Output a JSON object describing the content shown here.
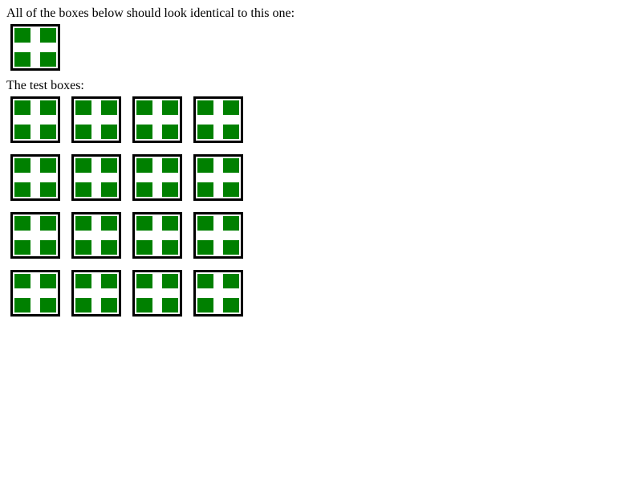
{
  "intro": {
    "text": "All of the boxes below should look identical to this one:"
  },
  "test": {
    "label": "The test boxes:",
    "rows": 4,
    "cols": 4
  },
  "colors": {
    "quadrant": "#008000",
    "border": "#000000",
    "background": "#ffffff"
  },
  "icons": {
    "box": "green-cross-box"
  }
}
